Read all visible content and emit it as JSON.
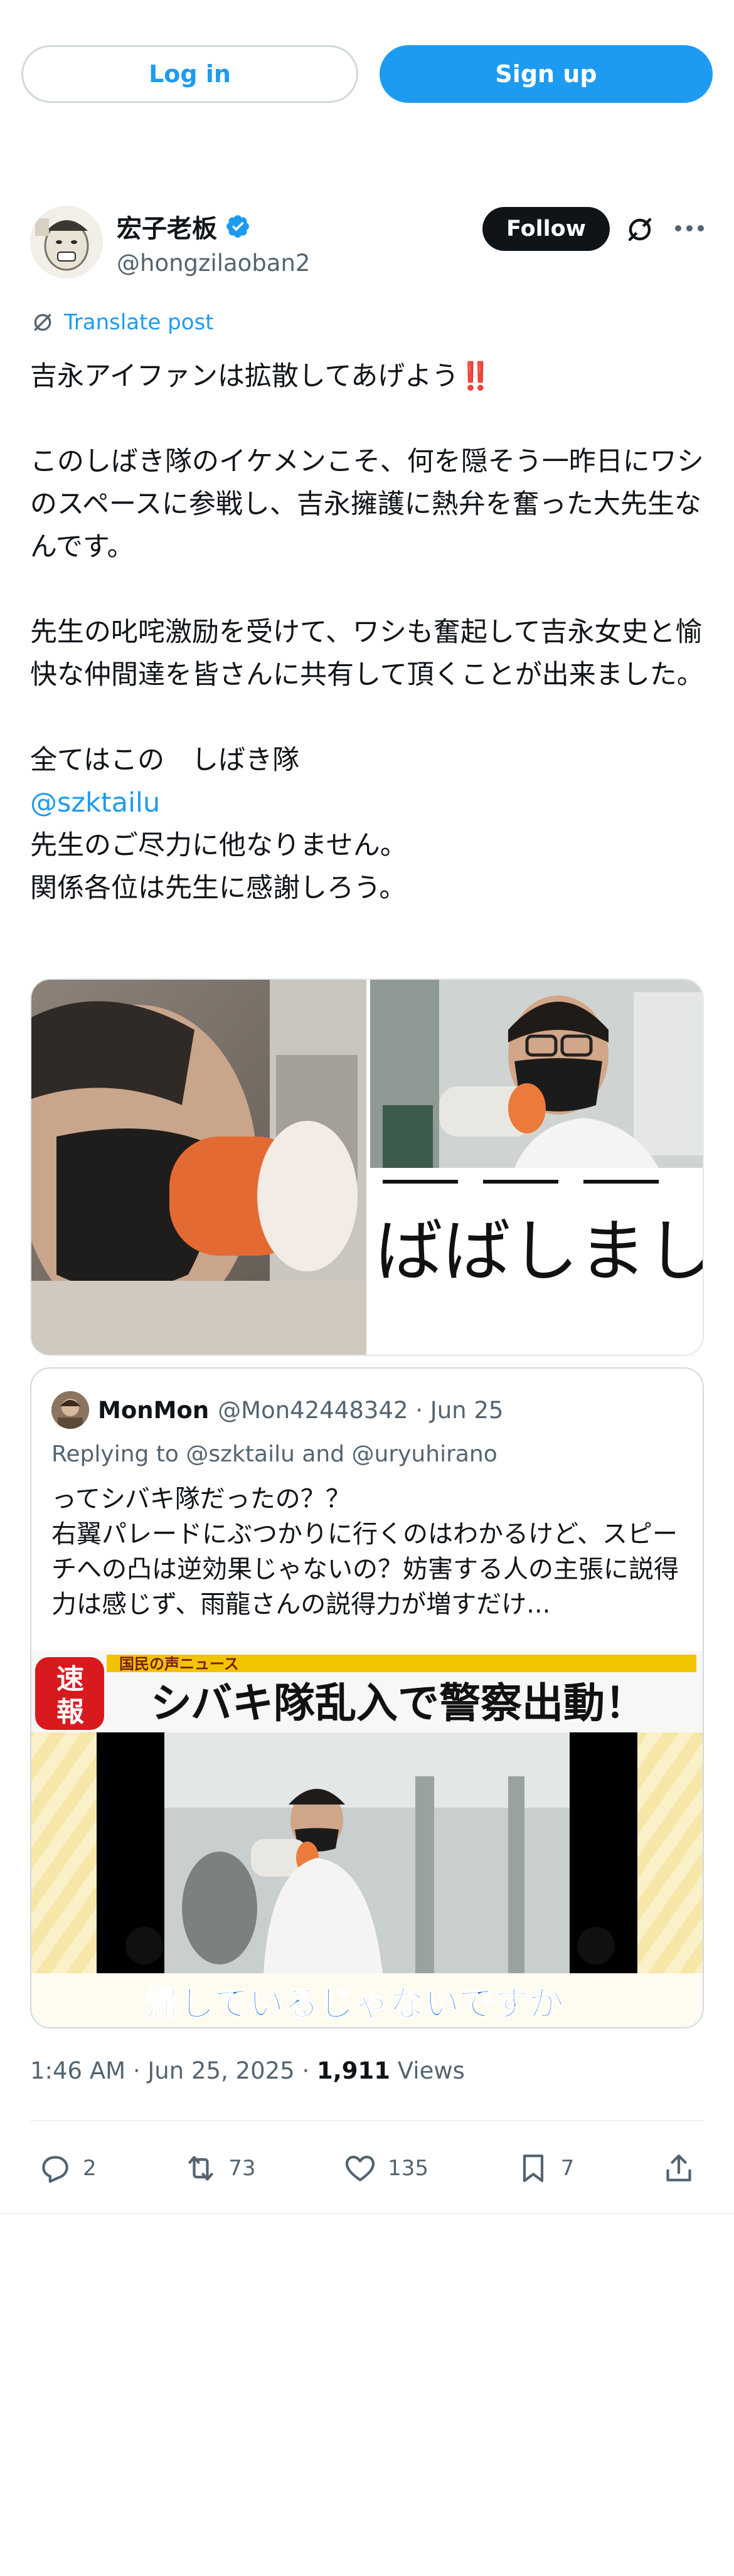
{
  "auth": {
    "login_label": "Log in",
    "signup_label": "Sign up"
  },
  "author": {
    "display_name": "宏子老板",
    "handle": "@hongzilaoban2",
    "follow_label": "Follow"
  },
  "translate_label": "Translate post",
  "tweet": {
    "line1": "吉永アイファンは拡散してあげよう",
    "bangbang": "‼️",
    "para2": "このしばき隊のイケメンこそ、何を隠そう一昨日にワシのスペースに参戦し、吉永擁護に熱弁を奮った大先生なんです。",
    "para3": "先生の叱咤激励を受けて、ワシも奮起して吉永女史と愉快な仲間達を皆さんに共有して頂くことが出来ました。",
    "para4_line1": "全てはこの　しばき隊",
    "mention": "@szktailu",
    "para4_line3": "先生のご尽力に他なりません。",
    "para4_line4": "関係各位は先生に感謝しろう。"
  },
  "media": {
    "right_caption": "ばばしまし"
  },
  "quote": {
    "name": "MonMon",
    "meta": "@Mon42448342 · Jun 25",
    "reply": "Replying to @szktailu and @uryuhirano",
    "text": "ってシバキ隊だったの？？\n右翼パレードにぶつかりに行くのはわかるけど、スピーチへの凸は逆効果じゃないの？妨害する人の主張に説得力は感じず、雨龍さんの説得力が増すだけ...",
    "image": {
      "badge_top": "速",
      "badge_bottom": "報",
      "news_tag": "国民の声ニュース",
      "headline": "シバキ隊乱入で警察出動！",
      "subtitle": "帰しているじゃないですか"
    }
  },
  "timestamp": {
    "time": "1:46 AM · Jun 25, 2025 · ",
    "views_count": "1,911",
    "views_label": " Views"
  },
  "actions": {
    "replies": "2",
    "reposts": "73",
    "likes": "135",
    "bookmarks": "7"
  },
  "colors": {
    "accent": "#1d9bf0",
    "text": "#0f1419",
    "muted": "#536471"
  }
}
